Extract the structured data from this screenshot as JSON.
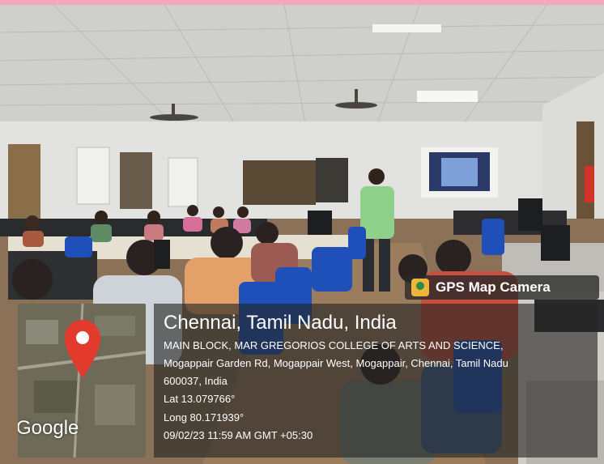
{
  "photo": {
    "description_icon": "classroom-photo",
    "dominant_colors": [
      "#c8c9c7",
      "#8a7c66",
      "#1f4fb8"
    ]
  },
  "gps": {
    "badge": "GPS Map Camera",
    "city": "Chennai, Tamil Nadu, India",
    "address_line1": "MAIN BLOCK, MAR GREGORIOS COLLEGE OF ARTS AND SCIENCE,",
    "address_line2": "Mogappair Garden Rd, Mogappair West, Mogappair, Chennai, Tamil Nadu",
    "address_line3": "600037, India",
    "lat": "Lat 13.079766°",
    "long": "Long 80.171939°",
    "datetime": "09/02/23 11:59 AM GMT +05:30",
    "map_brand": "Google",
    "pin_color": "#e23b2e"
  }
}
